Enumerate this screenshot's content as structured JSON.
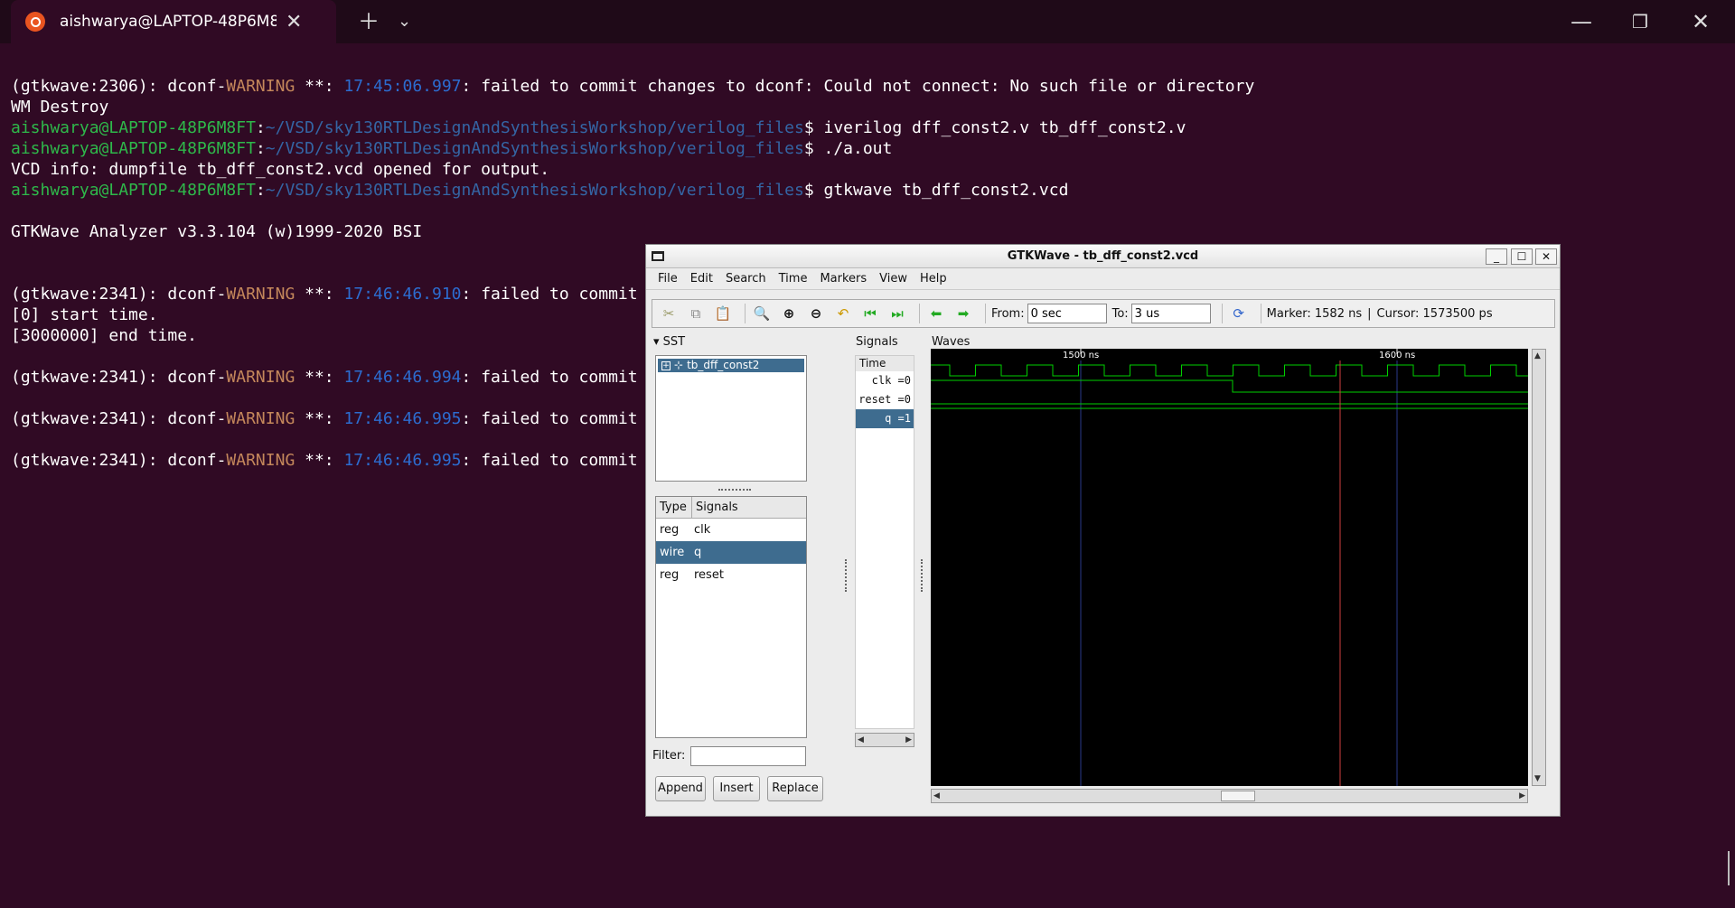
{
  "window": {
    "tab_title": "aishwarya@LAPTOP-48P6M8I"
  },
  "terminal": {
    "prompt_user": "aishwarya@LAPTOP-48P6M8FT",
    "prompt_path": "~/VSD/sky130RTLDesignAndSynthesisWorkshop/verilog_files",
    "lines": {
      "l1_pre": "(gtkwave:2306): dconf-",
      "l1_warn": "WARNING",
      "l1_mid": " **: ",
      "l1_time": "17:45:06.997",
      "l1_post": ": failed to commit changes to dconf: Could not connect: No such file or directory",
      "l2": "WM Destroy",
      "cmd1": "$ iverilog dff_const2.v tb_dff_const2.v",
      "cmd2": "$ ./a.out",
      "l5": "VCD info: dumpfile tb_dff_const2.vcd opened for output.",
      "cmd3": "$ gtkwave tb_dff_const2.vcd",
      "l8": "GTKWave Analyzer v3.3.104 (w)1999-2020 BSI",
      "w_pre": "(gtkwave:2341): dconf-",
      "w_warn": "WARNING",
      "w_mid": " **: ",
      "t1": "17:46:46.910",
      "t2": "17:46:46.994",
      "t3": "17:46:46.995",
      "t4": "17:46:46.995",
      "w_post": ": failed to commit",
      "l11": "[0] start time.",
      "l12": "[3000000] end time."
    }
  },
  "gtkwave": {
    "title": "GTKWave - tb_dff_const2.vcd",
    "menu": [
      "File",
      "Edit",
      "Search",
      "Time",
      "Markers",
      "View",
      "Help"
    ],
    "toolbar": {
      "from_label": "From:",
      "from_value": "0 sec",
      "to_label": "To:",
      "to_value": "3 us",
      "marker": "Marker: 1582 ns",
      "sep": "|",
      "cursor": "Cursor: 1573500 ps"
    },
    "sst": {
      "header": "SST",
      "module": "tb_dff_const2"
    },
    "sigtable": {
      "col_type": "Type",
      "col_signals": "Signals",
      "rows": [
        {
          "type": "reg",
          "name": "clk"
        },
        {
          "type": "wire",
          "name": "q"
        },
        {
          "type": "reg",
          "name": "reset"
        }
      ]
    },
    "filter_label": "Filter:",
    "buttons": {
      "append": "Append",
      "insert": "Insert",
      "replace": "Replace"
    },
    "signals_panel": {
      "header": "Signals",
      "time": "Time",
      "rows": [
        "clk =0",
        "reset =0",
        "q =1"
      ]
    },
    "waves": {
      "header": "Waves",
      "tick1": "1500 ns",
      "tick2": "1600 ns",
      "wave_color": "#00d000",
      "marker_color": "#d04040",
      "grid_color": "#2a3a8a"
    }
  }
}
